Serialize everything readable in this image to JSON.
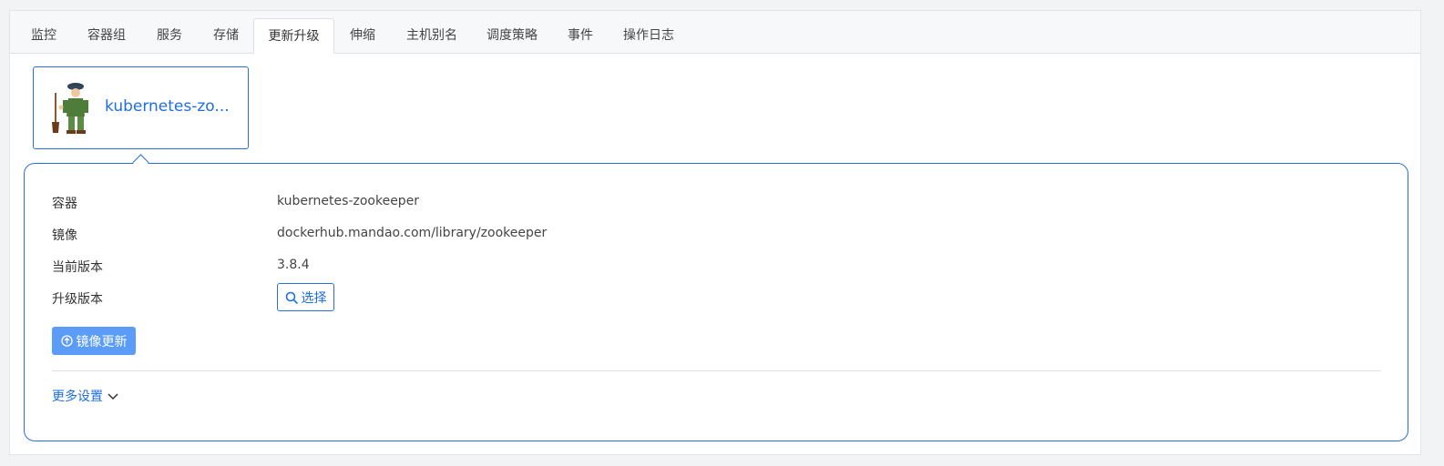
{
  "tabs": [
    {
      "label": "监控"
    },
    {
      "label": "容器组"
    },
    {
      "label": "服务"
    },
    {
      "label": "存储"
    },
    {
      "label": "更新升级"
    },
    {
      "label": "伸缩"
    },
    {
      "label": "主机别名"
    },
    {
      "label": "调度策略"
    },
    {
      "label": "事件"
    },
    {
      "label": "操作日志"
    }
  ],
  "active_tab": "更新升级",
  "container_card": {
    "name": "kubernetes-zo..."
  },
  "details": {
    "container_label": "容器",
    "container_value": "kubernetes-zookeeper",
    "image_label": "镜像",
    "image_value": "dockerhub.mandao.com/library/zookeeper",
    "current_version_label": "当前版本",
    "current_version_value": "3.8.4",
    "upgrade_version_label": "升级版本",
    "select_label": "选择"
  },
  "actions": {
    "update_image_label": "镜像更新",
    "more_settings_label": "更多设置"
  },
  "colors": {
    "accent": "#1f6fe0",
    "primary_button": "#5b9cf8",
    "border": "#dcdfe6"
  },
  "icons": {
    "select": "search-icon",
    "update": "upload-circle-icon",
    "more": "chevron-down-icon",
    "avatar": "zookeeper-avatar-icon"
  }
}
